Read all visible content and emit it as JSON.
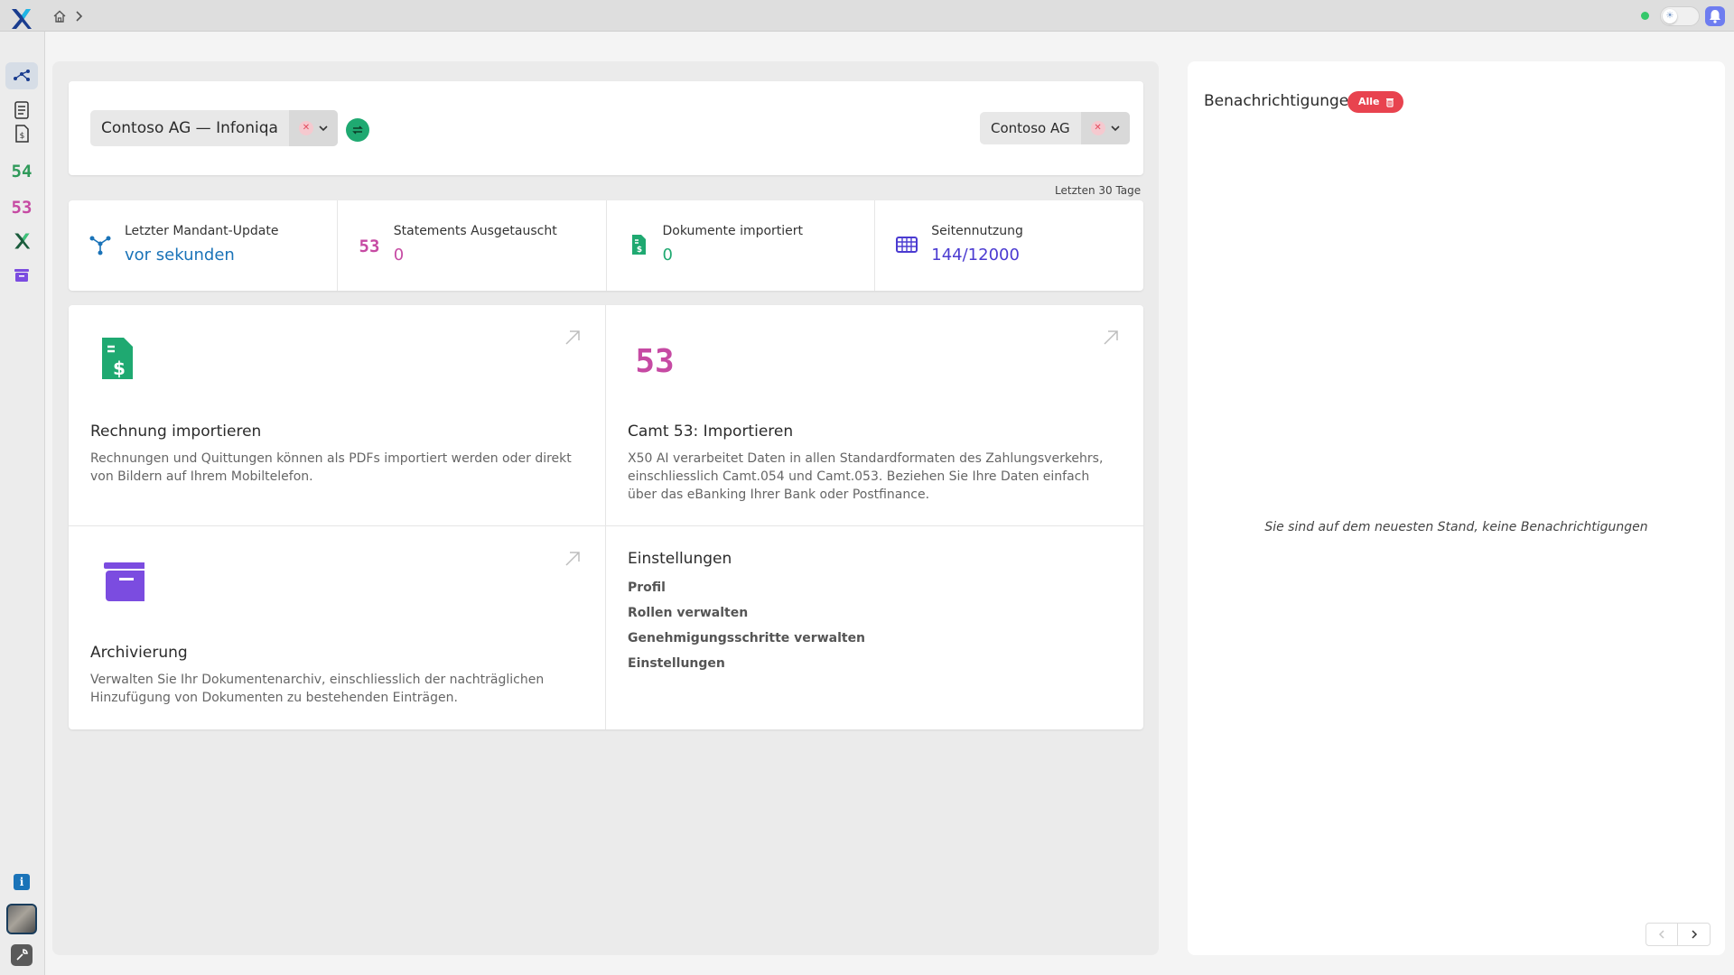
{
  "colors": {
    "accent_blue": "#1a73b8",
    "pink": "#c64aa3",
    "green": "#1fa971",
    "purple": "#4b3bd1",
    "archive_purple": "#7b4ce0",
    "danger": "#e8434f"
  },
  "topbar": {
    "logo_icon": "x-logo-icon",
    "home_icon": "home-icon",
    "breadcrumb_chevron": "chevron-right-icon",
    "theme_icon": "sun-icon"
  },
  "sidebar": {
    "items": [
      {
        "name": "network-icon",
        "active": true
      },
      {
        "name": "document-list-icon"
      },
      {
        "name": "invoice-icon"
      },
      {
        "name": "camt54-icon",
        "label": "54"
      },
      {
        "name": "camt53-icon",
        "label": "53"
      },
      {
        "name": "x50-icon"
      },
      {
        "name": "archive-icon"
      }
    ],
    "bottom": [
      {
        "name": "info-icon",
        "label": "i"
      },
      {
        "name": "avatar"
      },
      {
        "name": "tools-icon"
      }
    ]
  },
  "selectors": {
    "mandant": {
      "value": "Contoso AG — Infoniqa"
    },
    "company": {
      "value": "Contoso AG"
    }
  },
  "range_label": "Letzten 30 Tage",
  "stats": [
    {
      "label": "Letzter Mandant-Update",
      "value": "vor sekunden",
      "icon": "network-icon",
      "color": "#1a73b8"
    },
    {
      "label": "Statements Ausgetauscht",
      "value": "0",
      "icon": "camt53-icon",
      "color": "#c64aa3"
    },
    {
      "label": "Dokumente importiert",
      "value": "0",
      "icon": "invoice-icon",
      "color": "#1fa971"
    },
    {
      "label": "Seitennutzung",
      "value": "144/12000",
      "icon": "grid-icon",
      "color": "#4b3bd1"
    }
  ],
  "tiles": {
    "invoice": {
      "title": "Rechnung importieren",
      "desc": "Rechnungen und Quittungen können als PDFs importiert werden oder direkt von Bildern auf Ihrem Mobiltelefon."
    },
    "camt": {
      "icon_label": "53",
      "title": "Camt 53: Importieren",
      "desc": "X50 AI verarbeitet Daten in allen Standardformaten des Zahlungsverkehrs, einschliesslich Camt.054 und Camt.053. Beziehen Sie Ihre Daten einfach über das eBanking Ihrer Bank oder Postfinance."
    },
    "archive": {
      "title": "Archivierung",
      "desc": "Verwalten Sie Ihr Dokumentenarchiv, einschliesslich der nachträglichen Hinzufügung von Dokumenten zu bestehenden Einträgen."
    },
    "settings": {
      "title": "Einstellungen",
      "links": [
        "Profil",
        "Rollen verwalten",
        "Genehmigungsschritte verwalten",
        "Einstellungen"
      ]
    }
  },
  "notifications": {
    "title": "Benachrichtigungen",
    "badge": "Alle",
    "empty": "Sie sind auf dem neuesten Stand, keine Benachrichtigungen"
  }
}
